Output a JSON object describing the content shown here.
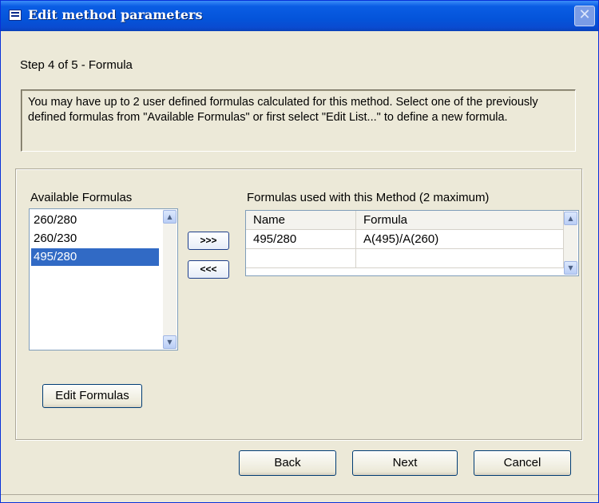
{
  "window": {
    "title": "Edit method parameters",
    "close_symbol": "✕"
  },
  "step": {
    "label": "Step 4 of 5 - Formula"
  },
  "info": {
    "text": "You may have up to 2 user defined formulas calculated for this method.  Select one of the previously defined formulas from \"Available Formulas\" or first select \"Edit List...\" to define a new formula."
  },
  "available": {
    "label": "Available Formulas",
    "items": [
      "260/280",
      "260/230",
      "495/280"
    ],
    "selected_index": 2
  },
  "transfer": {
    "add_label": ">>>",
    "remove_label": "<<<"
  },
  "used": {
    "label": "Formulas used with this Method (2 maximum)",
    "columns": [
      "Name",
      "Formula"
    ],
    "rows": [
      [
        "495/280",
        "A(495)/A(260)"
      ],
      [
        "",
        ""
      ]
    ]
  },
  "buttons": {
    "edit_formulas": "Edit Formulas",
    "back": "Back",
    "next": "Next",
    "cancel": "Cancel"
  },
  "icons": {
    "scroll_up": "▲",
    "scroll_down": "▼"
  }
}
